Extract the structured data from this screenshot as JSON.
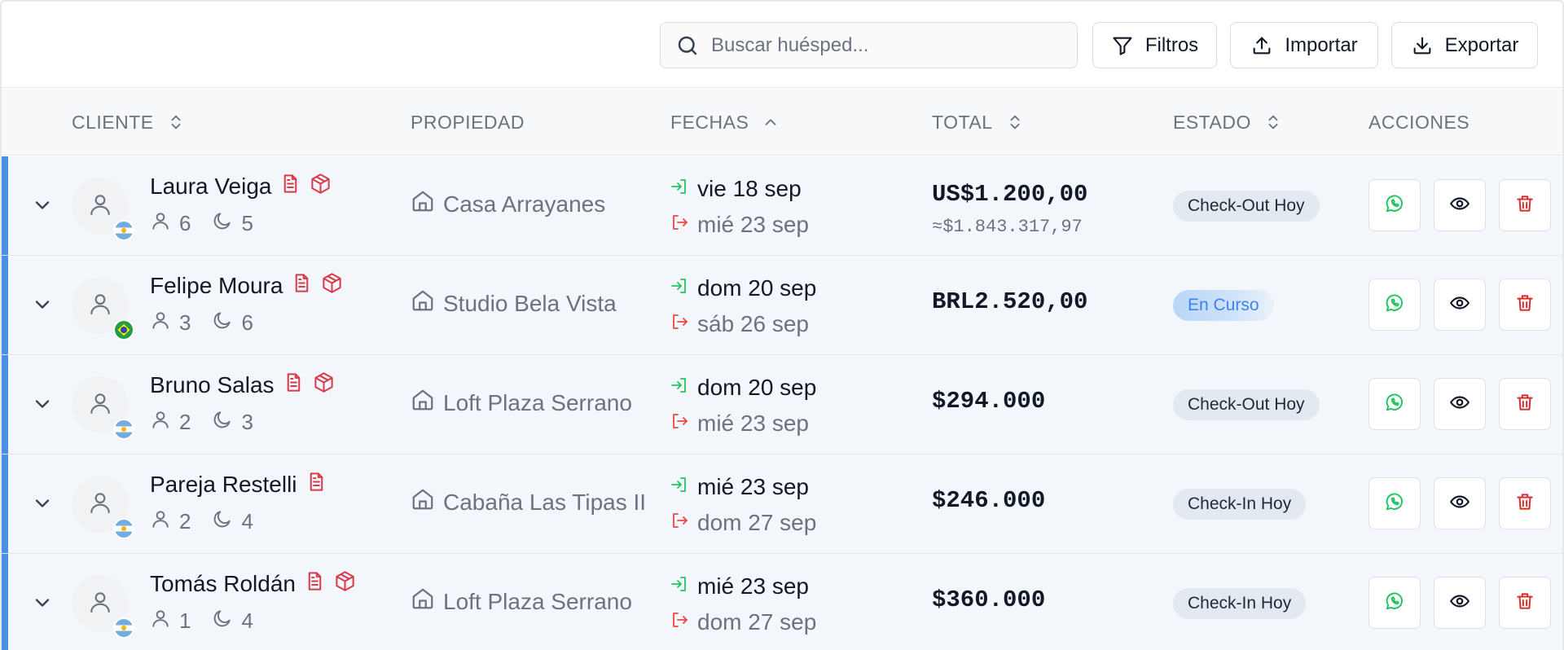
{
  "toolbar": {
    "search_placeholder": "Buscar huésped...",
    "filters_label": "Filtros",
    "import_label": "Importar",
    "export_label": "Exportar"
  },
  "columns": {
    "client": "CLIENTE",
    "property": "PROPIEDAD",
    "dates": "FECHAS",
    "total": "TOTAL",
    "status": "ESTADO",
    "actions": "ACCIONES"
  },
  "colors": {
    "accent": "#4a90e2",
    "doc_icon": "#d93a4a",
    "whatsapp": "#22c55e",
    "delete": "#dc2626",
    "checkin_arrow": "#22c55e",
    "checkout_arrow": "#ef4444"
  },
  "rows": [
    {
      "name": "Laura Veiga",
      "flag": "argentina-flag",
      "guests": "6",
      "nights": "5",
      "has_doc": true,
      "has_package": true,
      "property": "Casa Arrayanes",
      "checkin": "vie 18 sep",
      "checkout": "mié 23 sep",
      "total": "US$1.200,00",
      "total_converted": "≈$1.843.317,97",
      "status": "Check-Out Hoy"
    },
    {
      "name": "Felipe Moura",
      "flag": "brazil-flag",
      "guests": "3",
      "nights": "6",
      "has_doc": true,
      "has_package": true,
      "property": "Studio Bela Vista",
      "checkin": "dom 20 sep",
      "checkout": "sáb 26 sep",
      "total": "BRL2.520,00",
      "total_converted": "",
      "status": "En Curso"
    },
    {
      "name": "Bruno Salas",
      "flag": "argentina-flag",
      "guests": "2",
      "nights": "3",
      "has_doc": true,
      "has_package": true,
      "property": "Loft Plaza Serrano",
      "checkin": "dom 20 sep",
      "checkout": "mié 23 sep",
      "total": "$294.000",
      "total_converted": "",
      "status": "Check-Out Hoy"
    },
    {
      "name": "Pareja Restelli",
      "flag": "argentina-flag",
      "guests": "2",
      "nights": "4",
      "has_doc": true,
      "has_package": false,
      "property": "Cabaña Las Tipas II",
      "checkin": "mié 23 sep",
      "checkout": "dom 27 sep",
      "total": "$246.000",
      "total_converted": "",
      "status": "Check-In Hoy"
    },
    {
      "name": "Tomás Roldán",
      "flag": "argentina-flag",
      "guests": "1",
      "nights": "4",
      "has_doc": true,
      "has_package": true,
      "property": "Loft Plaza Serrano",
      "checkin": "mié 23 sep",
      "checkout": "dom 27 sep",
      "total": "$360.000",
      "total_converted": "",
      "status": "Check-In Hoy"
    }
  ]
}
